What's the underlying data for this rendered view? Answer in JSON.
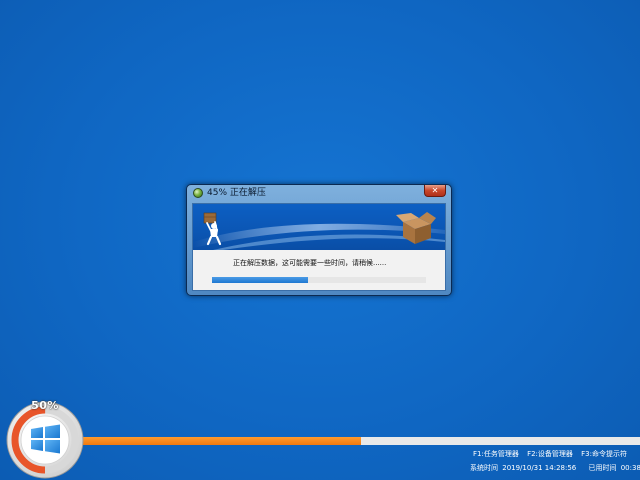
{
  "dialog": {
    "title": "45% 正在解压",
    "close_label": "✕",
    "message": "正在解压数据，这可能需要一些时间，请稍候......",
    "progress_fraction": 0.45
  },
  "installer": {
    "percent_label": "50%",
    "progress_fraction": 0.5
  },
  "shortcuts": [
    {
      "label": "F1:任务管理器"
    },
    {
      "label": "F2:设备管理器"
    },
    {
      "label": "F3:命令提示符"
    }
  ],
  "status": {
    "system_time_label": "系统时间",
    "system_time": "2019/10/31 14:28:56",
    "elapsed_label": "已用时间",
    "elapsed": "00:38"
  },
  "colors": {
    "desktop": "#1068c4",
    "orange_progress": "#f07a10",
    "blue_progress": "#1f78d1"
  },
  "icons": {
    "title": "green-orb-icon",
    "banner_left": "person-carrying-box-icon",
    "banner_right": "open-box-icon",
    "badge": "windows-logo-icon"
  }
}
